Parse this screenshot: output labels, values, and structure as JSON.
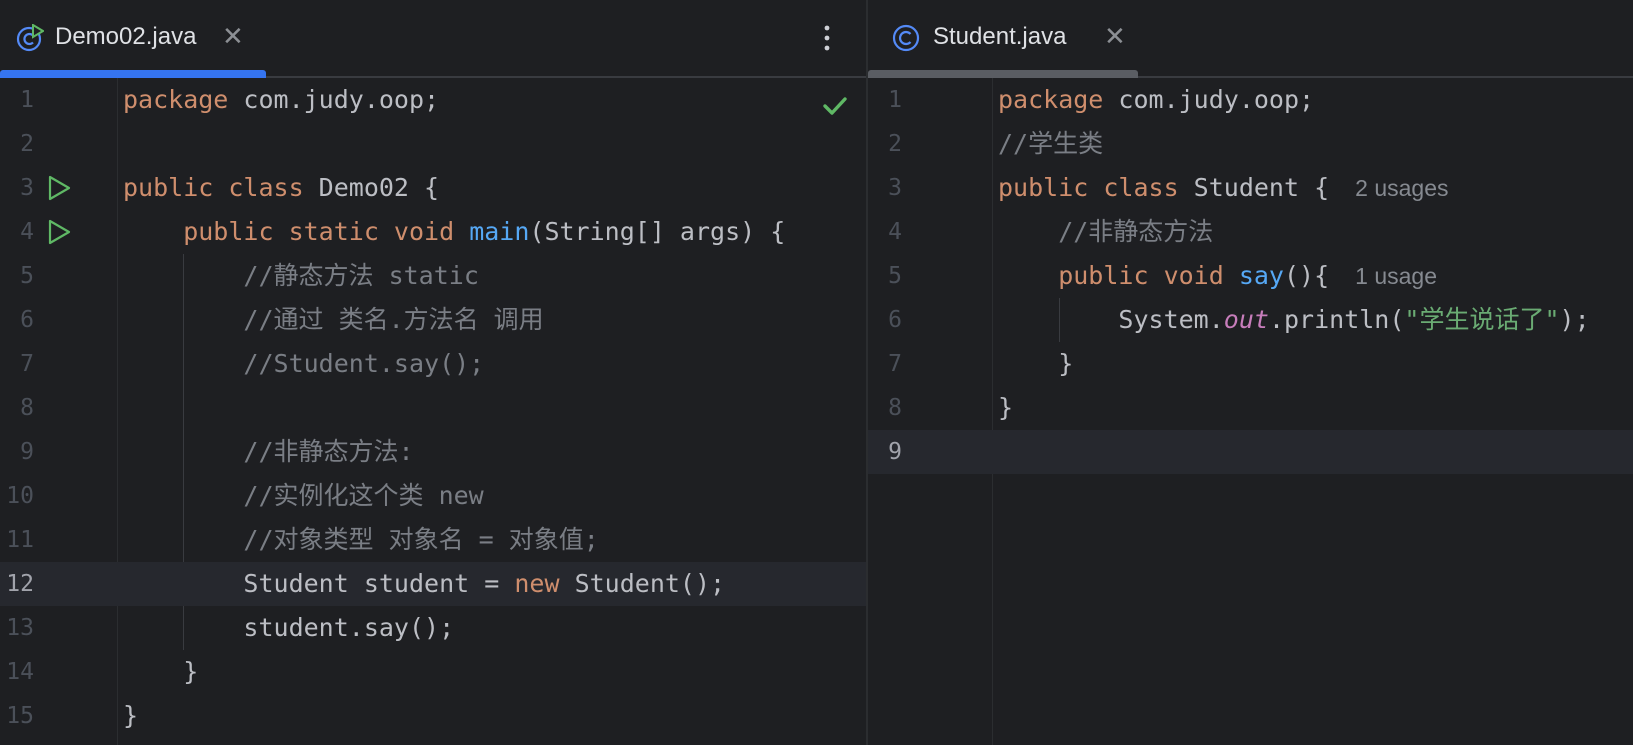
{
  "left": {
    "tab": {
      "title": "Demo02.java",
      "close_glyph": "✕"
    },
    "lines": [
      {
        "n": "1",
        "tokens": [
          {
            "t": "package ",
            "c": "kw"
          },
          {
            "t": "com.judy.oop;",
            "c": ""
          }
        ]
      },
      {
        "n": "2",
        "tokens": []
      },
      {
        "n": "3",
        "tokens": [
          {
            "t": "public class ",
            "c": "kw"
          },
          {
            "t": "Demo02 {",
            "c": ""
          }
        ]
      },
      {
        "n": "4",
        "tokens": [
          {
            "t": "    public static void ",
            "c": "kw"
          },
          {
            "t": "main",
            "c": "fn"
          },
          {
            "t": "(String[] args) {",
            "c": ""
          }
        ]
      },
      {
        "n": "5",
        "tokens": [
          {
            "t": "        //静态方法 static",
            "c": "cm"
          }
        ]
      },
      {
        "n": "6",
        "tokens": [
          {
            "t": "        //通过 类名.方法名 调用",
            "c": "cm"
          }
        ]
      },
      {
        "n": "7",
        "tokens": [
          {
            "t": "        //Student.say();",
            "c": "cm"
          }
        ]
      },
      {
        "n": "8",
        "tokens": []
      },
      {
        "n": "9",
        "tokens": [
          {
            "t": "        //非静态方法:",
            "c": "cm"
          }
        ]
      },
      {
        "n": "10",
        "tokens": [
          {
            "t": "        //实例化这个类 new",
            "c": "cm"
          }
        ]
      },
      {
        "n": "11",
        "tokens": [
          {
            "t": "        //对象类型 对象名 = 对象值;",
            "c": "cm"
          }
        ]
      },
      {
        "n": "12",
        "tokens": [
          {
            "t": "        Student student = ",
            "c": ""
          },
          {
            "t": "new ",
            "c": "kw"
          },
          {
            "t": "Student();",
            "c": ""
          }
        ]
      },
      {
        "n": "13",
        "tokens": [
          {
            "t": "        student.say();",
            "c": ""
          }
        ]
      },
      {
        "n": "14",
        "tokens": [
          {
            "t": "    }",
            "c": ""
          }
        ]
      },
      {
        "n": "15",
        "tokens": [
          {
            "t": "}",
            "c": ""
          }
        ]
      }
    ],
    "current_line": 12,
    "run_lines": [
      3,
      4
    ]
  },
  "right": {
    "tab": {
      "title": "Student.java",
      "close_glyph": "✕"
    },
    "lines": [
      {
        "n": "1",
        "tokens": [
          {
            "t": "package ",
            "c": "kw"
          },
          {
            "t": "com.judy.oop;",
            "c": ""
          }
        ]
      },
      {
        "n": "2",
        "tokens": [
          {
            "t": "//学生类",
            "c": "cm"
          }
        ]
      },
      {
        "n": "3",
        "tokens": [
          {
            "t": "public class ",
            "c": "kw"
          },
          {
            "t": "Student {",
            "c": ""
          }
        ],
        "hint": "2 usages"
      },
      {
        "n": "4",
        "tokens": [
          {
            "t": "    //非静态方法",
            "c": "cm"
          }
        ]
      },
      {
        "n": "5",
        "tokens": [
          {
            "t": "    public void ",
            "c": "kw"
          },
          {
            "t": "say",
            "c": "fn"
          },
          {
            "t": "(){",
            "c": ""
          }
        ],
        "hint": "1 usage"
      },
      {
        "n": "6",
        "tokens": [
          {
            "t": "        System.",
            "c": ""
          },
          {
            "t": "out",
            "c": "fld"
          },
          {
            "t": ".println(",
            "c": ""
          },
          {
            "t": "\"学生说话了\"",
            "c": "str"
          },
          {
            "t": ");",
            "c": ""
          }
        ]
      },
      {
        "n": "7",
        "tokens": [
          {
            "t": "    }",
            "c": ""
          }
        ]
      },
      {
        "n": "8",
        "tokens": [
          {
            "t": "}",
            "c": ""
          }
        ]
      },
      {
        "n": "9",
        "tokens": []
      }
    ],
    "current_line": 9
  },
  "colors": {
    "accent": "#3574f0",
    "keyword": "#cf8e6d",
    "function": "#56a8f5",
    "comment": "#7a7e85",
    "string": "#6aab73",
    "field": "#c77dbb",
    "run": "#5fb865",
    "ok": "#5fb865"
  }
}
